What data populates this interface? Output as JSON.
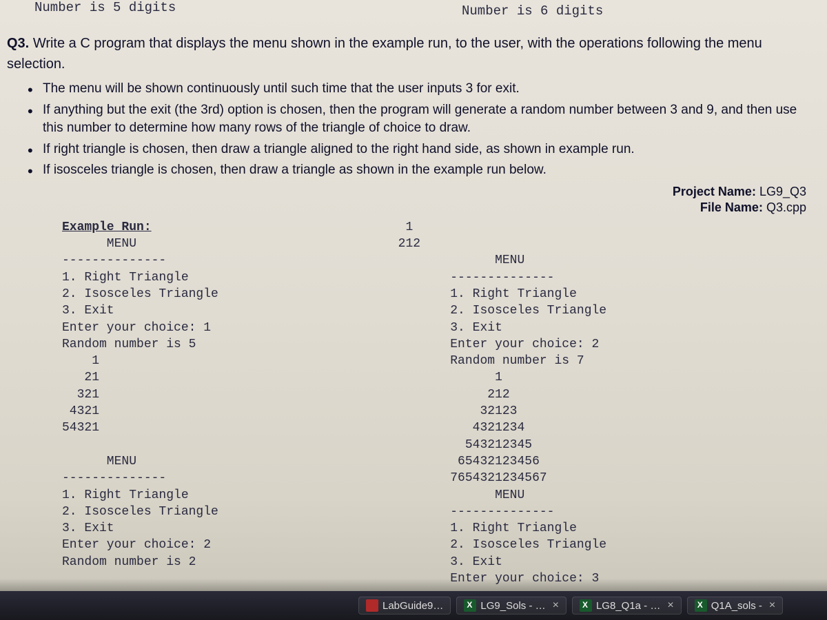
{
  "top": {
    "left_fragment": "Number is 5 digits",
    "right_fragment": "Number is 6 digits"
  },
  "question": {
    "number": "Q3.",
    "prompt_line1": "Write a C program that displays the menu shown in the example run, to the user, with the operations following the menu",
    "prompt_line2": "selection.",
    "bullets": [
      "The menu will be shown continuously until such time that the user inputs 3 for exit.",
      "If anything but the exit (the 3rd) option is chosen, then the program will generate a random number between 3 and 9, and then use this number to determine how many rows of the triangle of choice to draw.",
      "If right triangle is chosen, then draw a triangle aligned to the right hand side, as shown in example run.",
      "If isosceles triangle is chosen, then draw a triangle as shown in the example run below."
    ]
  },
  "project": {
    "name_label": "Project Name:",
    "name_value": "LG9_Q3",
    "file_label": "File Name:",
    "file_value": "Q3.cpp"
  },
  "example": {
    "heading": "Example Run:",
    "left_block": "      MENU\n--------------\n1. Right Triangle\n2. Isosceles Triangle\n3. Exit\nEnter your choice: 1\nRandom number is 5\n    1\n   21\n  321\n 4321\n54321\n\n      MENU\n--------------\n1. Right Triangle\n2. Isosceles Triangle\n3. Exit\nEnter your choice: 2\nRandom number is 2",
    "right_block": "  1\n 212\n              MENU\n        --------------\n        1. Right Triangle\n        2. Isosceles Triangle\n        3. Exit\n        Enter your choice: 2\n        Random number is 7\n              1\n             212\n            32123\n           4321234\n          543212345\n         65432123456\n        7654321234567\n              MENU\n        --------------\n        1. Right Triangle\n        2. Isosceles Triangle\n        3. Exit\n        Enter your choice: 3"
  },
  "taskbar": {
    "items": [
      {
        "label": "LabGuide9…",
        "kind": "pdf"
      },
      {
        "label": "LG9_Sols - …",
        "kind": "excel"
      },
      {
        "label": "LG8_Q1a - …",
        "kind": "excel"
      },
      {
        "label": "Q1A_sols -",
        "kind": "excel"
      }
    ]
  }
}
